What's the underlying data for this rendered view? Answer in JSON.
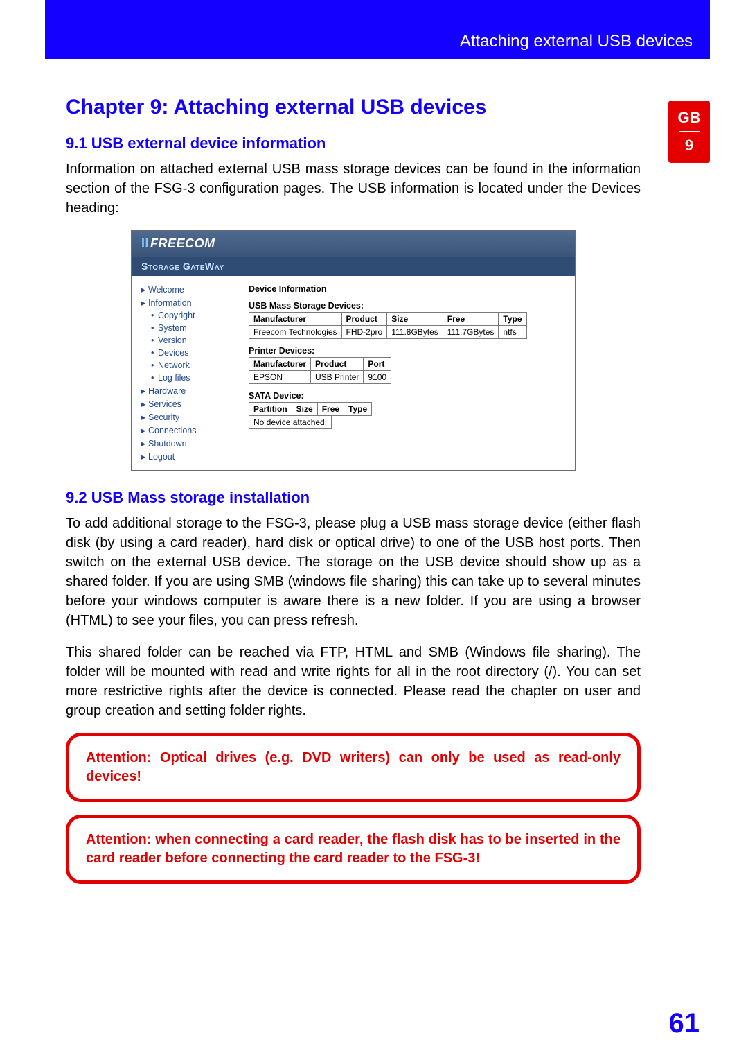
{
  "header": {
    "title": "Attaching external USB devices"
  },
  "side_tab": {
    "lang": "GB",
    "chapter": "9"
  },
  "chapter_title": "Chapter 9:  Attaching external USB devices",
  "section_9_1": {
    "heading": "9.1 USB external device information",
    "para": "Information on attached external USB mass storage devices can be found in the information section of the FSG-3 configuration pages. The USB information is located under the Devices heading:"
  },
  "app": {
    "brand_prefix": "II",
    "brand": "FREECOM",
    "subtitle": "Storage GateWay",
    "nav": [
      {
        "label": "Welcome",
        "indent": false
      },
      {
        "label": "Information",
        "indent": false
      },
      {
        "label": "Copyright",
        "indent": true
      },
      {
        "label": "System",
        "indent": true
      },
      {
        "label": "Version",
        "indent": true
      },
      {
        "label": "Devices",
        "indent": true
      },
      {
        "label": "Network",
        "indent": true
      },
      {
        "label": "Log files",
        "indent": true
      },
      {
        "label": "Hardware",
        "indent": false
      },
      {
        "label": "Services",
        "indent": false
      },
      {
        "label": "Security",
        "indent": false
      },
      {
        "label": "Connections",
        "indent": false
      },
      {
        "label": "Shutdown",
        "indent": false
      },
      {
        "label": "Logout",
        "indent": false
      }
    ],
    "main_title": "Device Information",
    "usb_title": "USB Mass Storage Devices:",
    "usb_headers": [
      "Manufacturer",
      "Product",
      "Size",
      "Free",
      "Type"
    ],
    "usb_row": [
      "Freecom Technologies",
      "FHD-2pro",
      "111.8GBytes",
      "111.7GBytes",
      "ntfs"
    ],
    "printer_title": "Printer Devices:",
    "printer_headers": [
      "Manufacturer",
      "Product",
      "Port"
    ],
    "printer_row": [
      "EPSON",
      "USB Printer",
      "9100"
    ],
    "sata_title": "SATA Device:",
    "sata_headers": [
      "Partition",
      "Size",
      "Free",
      "Type"
    ],
    "sata_empty": "No device attached."
  },
  "section_9_2": {
    "heading": "9.2 USB Mass storage installation",
    "para1": "To add additional storage to the FSG-3, please plug a USB mass storage device (either flash disk (by using a card reader), hard disk or optical drive) to one of the USB host ports. Then switch on the external USB device. The storage on the USB device should show up as a shared folder. If you are using SMB (windows file sharing) this can take up to several minutes before your windows computer is aware there is a new folder. If you are using a browser (HTML) to see your files, you can press refresh.",
    "para2": "This shared folder can be reached via FTP, HTML and SMB (Windows file sharing). The folder will be mounted with read and write rights for all in the root directory (/). You can set more restrictive rights after the device is connected. Please read the chapter on user and group creation and setting folder rights."
  },
  "attention1": "Attention: Optical drives (e.g. DVD writers) can only be used as read-only devices!",
  "attention2": "Attention: when connecting a card reader, the flash disk has to be inserted in the card reader before connecting the card reader to the FSG-3!",
  "page_number": "61"
}
